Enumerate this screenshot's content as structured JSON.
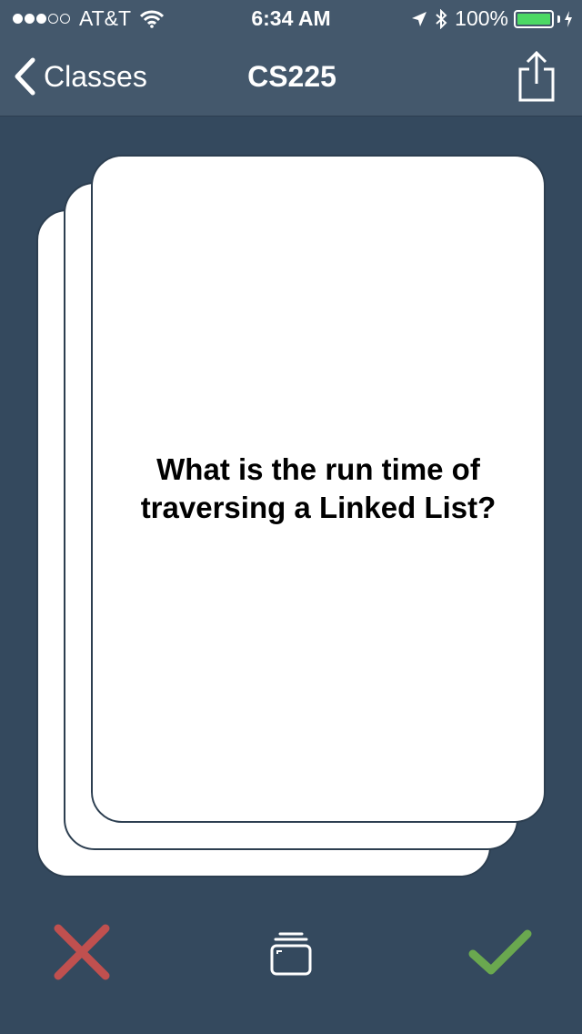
{
  "status_bar": {
    "carrier": "AT&T",
    "time": "6:34 AM",
    "battery_percent": "100%",
    "battery_level": 1.0,
    "signal_bars_filled": 3,
    "signal_bars_total": 5
  },
  "nav": {
    "back_label": "Classes",
    "title": "CS225"
  },
  "card": {
    "question": "What is the run time of traversing a Linked List?"
  },
  "icons": {
    "back": "chevron-left-icon",
    "share": "share-icon",
    "wrong": "x-mark-icon",
    "deck": "card-deck-icon",
    "correct": "checkmark-icon"
  },
  "colors": {
    "background": "#34495e",
    "nav_bar": "#44586c",
    "wrong": "#c0504f",
    "correct": "#6aa84f",
    "battery": "#4cd964"
  }
}
